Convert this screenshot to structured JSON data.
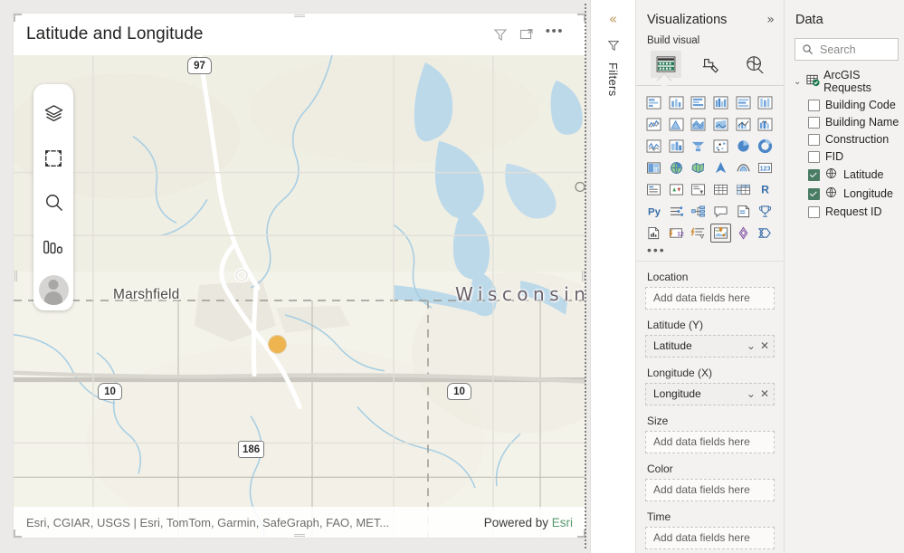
{
  "visual": {
    "title": "Latitude and Longitude",
    "header_icons": [
      {
        "name": "filter-icon",
        "label": "Filters"
      },
      {
        "name": "focus-mode-icon",
        "label": "Focus mode"
      },
      {
        "name": "more-options-icon",
        "label": "More options"
      }
    ],
    "more_options_glyph": "•••"
  },
  "map": {
    "toolbar": [
      {
        "name": "layers-icon",
        "label": "Layers"
      },
      {
        "name": "selection-tool-icon",
        "label": "Selection tool"
      },
      {
        "name": "search-icon",
        "label": "Search"
      },
      {
        "name": "analysis-icon",
        "label": "Analysis"
      },
      {
        "name": "basemap-avatar-icon",
        "label": "Basemap"
      }
    ],
    "labels": [
      {
        "text": "Marshfield",
        "type": "city"
      },
      {
        "text": "Wisconsin",
        "type": "state"
      }
    ],
    "shields": [
      {
        "text": "97",
        "type": "us"
      },
      {
        "text": "10",
        "type": "us"
      },
      {
        "text": "10",
        "type": "us"
      },
      {
        "text": "186",
        "type": "state"
      }
    ],
    "attribution": "Esri, CGIAR, USGS | Esri, TomTom, Garmin, SafeGraph, FAO, MET...",
    "powered_by_prefix": "Powered by ",
    "powered_by_brand": "Esri",
    "point_color": "#eeb44f"
  },
  "filters_rail": {
    "expand_glyph": "«",
    "label": "Filters",
    "icon": "filter-icon"
  },
  "visualizations": {
    "title": "Visualizations",
    "expand_glyph": "»",
    "build_label": "Build visual",
    "tabs": [
      {
        "name": "tab-build-visual",
        "label": "Build visual",
        "active": true
      },
      {
        "name": "tab-format-visual",
        "label": "Format visual",
        "active": false
      },
      {
        "name": "tab-analytics",
        "label": "Analytics",
        "active": false
      }
    ],
    "chart_types": [
      "stacked-bar-chart",
      "stacked-column-chart",
      "clustered-bar-chart",
      "clustered-column-chart",
      "100-stacked-bar-chart",
      "100-stacked-column-chart",
      "line-chart",
      "area-chart",
      "stacked-area-chart",
      "line-stacked-column-chart",
      "line-clustered-column-chart",
      "ribbon-chart",
      "waterfall-chart",
      "funnel-chart",
      "scatter-chart",
      "pie-chart",
      "donut-chart",
      "treemap",
      "map",
      "filled-map",
      "shape-map",
      "azure-map",
      "gauge",
      "card",
      "multi-row-card",
      "kpi",
      "slicer",
      "table",
      "matrix",
      "r-script-visual",
      "py-script-visual",
      "key-influencers",
      "decomposition-tree",
      "qa-visual",
      "smart-narrative",
      "metrics",
      "paginated-report",
      "power-apps",
      "power-automate",
      "arcgis-maps-for-power-bi",
      "visio-visual",
      "azure-synapse"
    ],
    "selected_chart_type": "arcgis-maps-for-power-bi",
    "more_glyph": "•••",
    "wells": [
      {
        "name": "location",
        "label": "Location",
        "placeholder": "Add data fields here",
        "value": null
      },
      {
        "name": "latitude-y",
        "label": "Latitude (Y)",
        "placeholder": "Add data fields here",
        "value": "Latitude"
      },
      {
        "name": "longitude-x",
        "label": "Longitude (X)",
        "placeholder": "Add data fields here",
        "value": "Longitude"
      },
      {
        "name": "size",
        "label": "Size",
        "placeholder": "Add data fields here",
        "value": null
      },
      {
        "name": "color",
        "label": "Color",
        "placeholder": "Add data fields here",
        "value": null
      },
      {
        "name": "time",
        "label": "Time",
        "placeholder": "Add data fields here",
        "value": null
      }
    ],
    "chip_caret": "⌄",
    "chip_remove": "✕"
  },
  "data": {
    "title": "Data",
    "search_placeholder": "Search",
    "table": {
      "name": "ArcGIS Requests",
      "expanded": true,
      "caret": "⌄"
    },
    "fields": [
      {
        "label": "Building Code",
        "checked": false,
        "geo": false
      },
      {
        "label": "Building Name",
        "checked": false,
        "geo": false
      },
      {
        "label": "Construction",
        "checked": false,
        "geo": false
      },
      {
        "label": "FID",
        "checked": false,
        "geo": false
      },
      {
        "label": "Latitude",
        "checked": true,
        "geo": true
      },
      {
        "label": "Longitude",
        "checked": true,
        "geo": true
      },
      {
        "label": "Request ID",
        "checked": false,
        "geo": false
      }
    ]
  }
}
